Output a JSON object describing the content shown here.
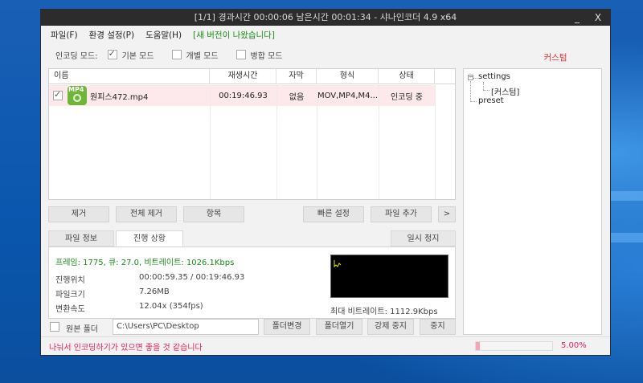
{
  "window": {
    "title": "[1/1] 경과시간 00:00:06  남은시간 00:01:34 - 샤나인코더 4.9 x64",
    "minimize_label": "_",
    "close_label": "X"
  },
  "menu": {
    "items": [
      "파일(F)",
      "환경 설정(P)",
      "도움말(H)"
    ],
    "notice": "[새 버전이 나왔습니다]"
  },
  "mode": {
    "label": "인코딩 모드:",
    "basic": "기본 모드",
    "individual": "개별 모드",
    "merge": "병합 모드",
    "selected": "basic"
  },
  "file_table": {
    "columns": [
      "이름",
      "재생시간",
      "자막",
      "형식",
      "상태"
    ],
    "rows": [
      {
        "checked": true,
        "icon": "mp4-icon",
        "icon_label": "MP4",
        "name": "원피스472.mp4",
        "duration": "00:19:46.93",
        "subtitle": "없음",
        "format": "MOV,MP4,M4...",
        "status": "인코딩 중"
      }
    ]
  },
  "actions": {
    "remove": "제거",
    "remove_all": "전체 제거",
    "item": "항목",
    "quick_settings": "빠른 설정",
    "add_file": "파일 추가",
    "more": ">"
  },
  "tabs": {
    "file_info": "파일 정보",
    "progress": "진행 상황",
    "pause": "일시 정지",
    "active": "progress"
  },
  "progress": {
    "stats": "프레임: 1775, 큐: 27.0, 비트레이트: 1026.1Kbps",
    "position_label": "진행위치",
    "position_value": "00:00:59.35 / 00:19:46.93",
    "size_label": "파일크기",
    "size_value": "7.26MB",
    "speed_label": "변환속도",
    "speed_value": "12.04x (354fps)",
    "max_bitrate": "최대 비트레이트: 1112.9Kbps"
  },
  "output": {
    "source_folder_label": "원본 폴더",
    "path": "C:\\Users\\PC\\Desktop",
    "change_folder": "폴더변경",
    "open_folder": "폴더열기",
    "force_stop": "강제 중지",
    "stop": "중지"
  },
  "status": {
    "message": "나눠서 인코딩하기가 있으면 좋을 것 같습니다",
    "percent_text": "5.00%",
    "percent_value": 0.05
  },
  "sidebar": {
    "label": "커스텀",
    "tree": {
      "root": "settings",
      "child": "[커스텀]",
      "sibling": "preset"
    }
  },
  "colors": {
    "title_bg": "#2c2c2c",
    "notice": "#1a8a1a",
    "accent_pink": "#e0245e",
    "row_highlight": "#fde8ec",
    "custom_label": "#e03030"
  }
}
